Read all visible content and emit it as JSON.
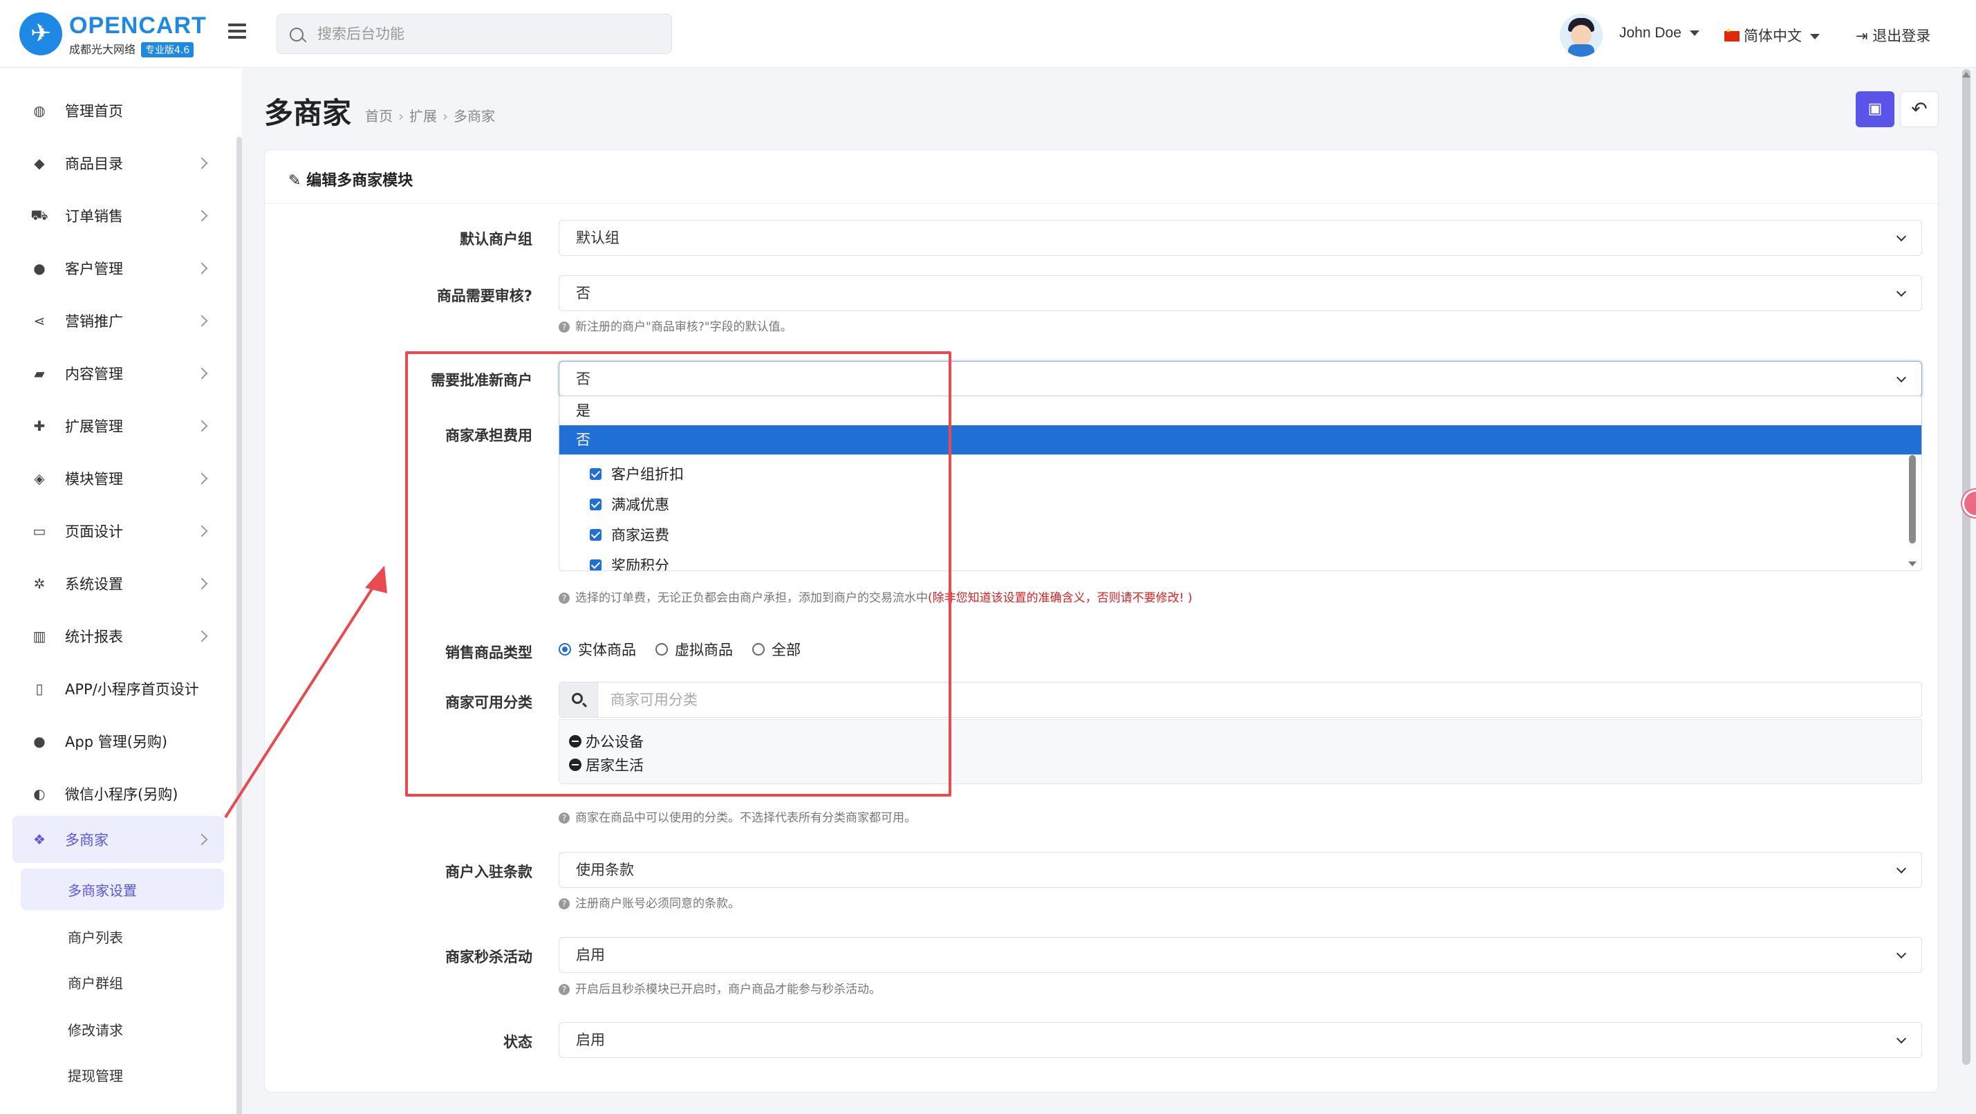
{
  "header": {
    "logo_title": "OPENCART",
    "logo_sub": "成都光大网络",
    "logo_badge": "专业版4.6",
    "search_placeholder": "搜索后台功能",
    "user_name": "John Doe",
    "language": "简体中文",
    "logout": "退出登录"
  },
  "sidebar": {
    "items": [
      {
        "label": "管理首页",
        "icon": "dashboard-icon",
        "glyph": "◍"
      },
      {
        "label": "商品目录",
        "icon": "tags-icon",
        "glyph": "◆"
      },
      {
        "label": "订单销售",
        "icon": "cart-icon",
        "glyph": "⛟"
      },
      {
        "label": "客户管理",
        "icon": "user-icon",
        "glyph": "●"
      },
      {
        "label": "营销推广",
        "icon": "share-icon",
        "glyph": "⋖"
      },
      {
        "label": "内容管理",
        "icon": "book-icon",
        "glyph": "▰"
      },
      {
        "label": "扩展管理",
        "icon": "puzzle-icon",
        "glyph": "✚"
      },
      {
        "label": "模块管理",
        "icon": "cube-icon",
        "glyph": "◈"
      },
      {
        "label": "页面设计",
        "icon": "desktop-icon",
        "glyph": "▭"
      },
      {
        "label": "系统设置",
        "icon": "cog-icon",
        "glyph": "✲"
      },
      {
        "label": "统计报表",
        "icon": "bar-chart-icon",
        "glyph": "▥"
      },
      {
        "label": "APP/小程序首页设计",
        "icon": "mobile-icon",
        "glyph": "▯"
      },
      {
        "label": "App 管理(另购)",
        "icon": "apple-icon",
        "glyph": "●"
      },
      {
        "label": "微信小程序(另购)",
        "icon": "wechat-icon",
        "glyph": "◐"
      },
      {
        "label": "多商家",
        "icon": "dropbox-icon",
        "glyph": "❖"
      }
    ],
    "sub_items": [
      "多商家设置",
      "商户列表",
      "商户群组",
      "修改请求",
      "提现管理"
    ]
  },
  "page": {
    "title": "多商家",
    "breadcrumb": [
      "首页",
      "扩展",
      "多商家"
    ],
    "card_title": "编辑多商家模块"
  },
  "form": {
    "default_group": {
      "label": "默认商户组",
      "value": "默认组"
    },
    "product_review": {
      "label": "商品需要审核?",
      "value": "否",
      "help": "新注册的商户\"商品审核?\"字段的默认值。"
    },
    "approve_new": {
      "label": "需要批准新商户",
      "value": "否",
      "options": [
        "是",
        "否"
      ],
      "selected": "否"
    },
    "merchant_fees": {
      "label": "商家承担费用",
      "checkboxes": [
        "客户组折扣",
        "满减优惠",
        "商家运费",
        "奖励积分"
      ],
      "help": "选择的订单费，无论正负都会由商户承担，添加到商户的交易流水中",
      "help_warn": "(除非您知道该设置的准确含义，否则请不要修改! )"
    },
    "product_type": {
      "label": "销售商品类型",
      "options": [
        "实体商品",
        "虚拟商品",
        "全部"
      ],
      "selected": "实体商品"
    },
    "categories": {
      "label": "商家可用分类",
      "placeholder": "商家可用分类",
      "items": [
        "办公设备",
        "居家生活"
      ],
      "help": "商家在商品中可以使用的分类。不选择代表所有分类商家都可用。"
    },
    "terms": {
      "label": "商户入驻条款",
      "value": "使用条款",
      "help": "注册商户账号必须同意的条款。"
    },
    "flash_sale": {
      "label": "商家秒杀活动",
      "value": "启用",
      "help": "开启后且秒杀模块已开启时，商户商品才能参与秒杀活动。"
    },
    "status": {
      "label": "状态",
      "value": "启用"
    }
  },
  "colors": {
    "accent": "#5a55e8",
    "select_blue": "#1f6fd6",
    "annotation_red": "#e84a4f",
    "warn": "#e02020"
  }
}
